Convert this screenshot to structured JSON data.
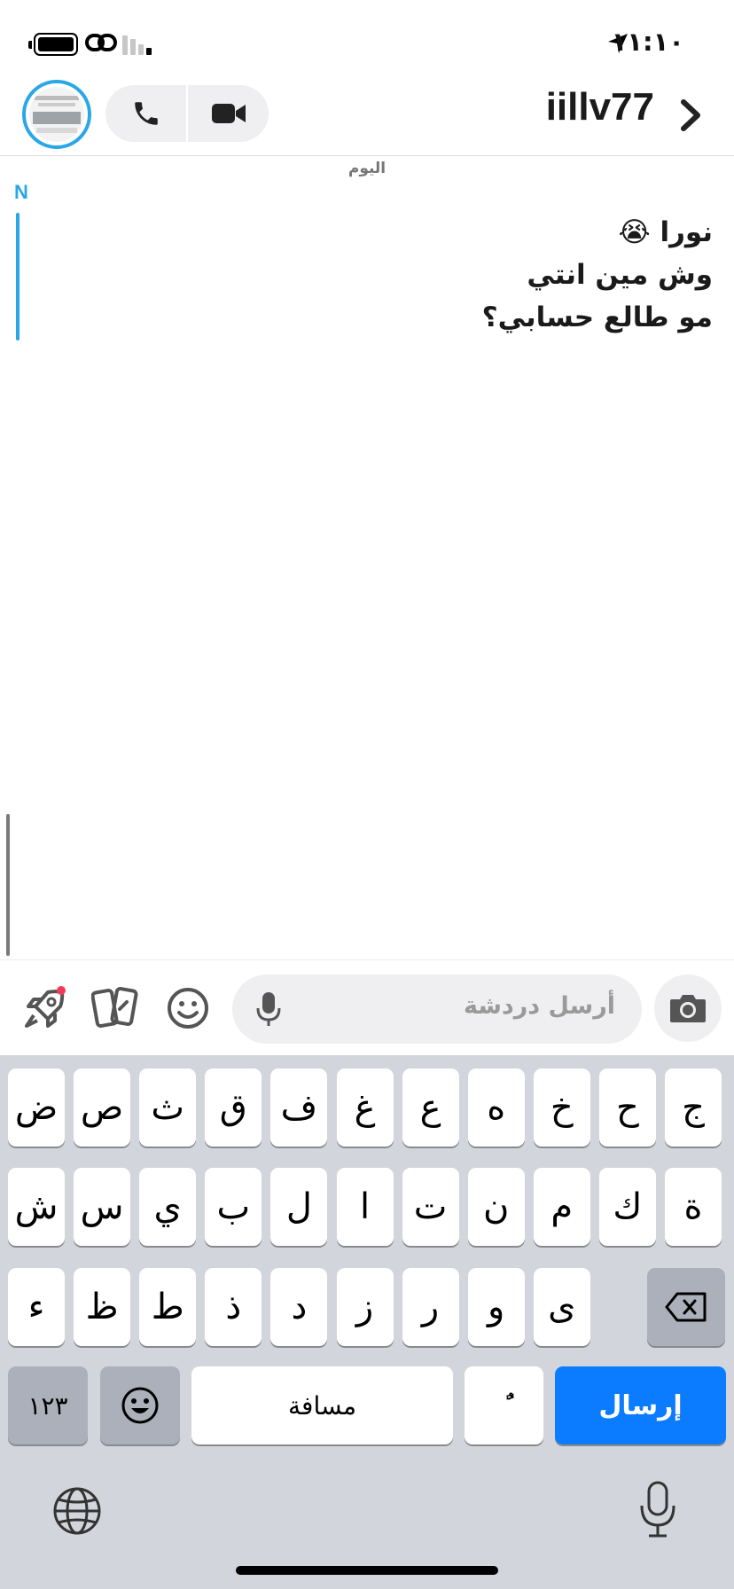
{
  "status_bar": {
    "time": "١١:١٠",
    "icons": [
      "battery-icon",
      "link-icon",
      "signal-icon",
      "location-arrow-icon"
    ]
  },
  "header": {
    "username": "iillv77",
    "icons": [
      "avatar",
      "phone-icon",
      "video-camera-icon",
      "chevron-right-icon"
    ]
  },
  "chat": {
    "date_label": "اليوم",
    "sender_initial": "N",
    "message_lines": [
      "نورا 😭",
      "وش مين انتي",
      "مو طالع حسابي؟"
    ]
  },
  "composer": {
    "placeholder": "أرسل دردشة",
    "icons": [
      "rocket-icon",
      "cards-icon",
      "smiley-icon",
      "microphone-icon",
      "camera-icon"
    ]
  },
  "keyboard": {
    "row1": [
      "ض",
      "ص",
      "ث",
      "ق",
      "ف",
      "غ",
      "ع",
      "ه",
      "خ",
      "ح",
      "ج"
    ],
    "row2": [
      "ش",
      "س",
      "ي",
      "ب",
      "ل",
      "ا",
      "ت",
      "ن",
      "م",
      "ك",
      "ة"
    ],
    "row3": [
      "ء",
      "ظ",
      "ط",
      "ذ",
      "د",
      "ز",
      "ر",
      "و",
      "ى"
    ],
    "numbers_key": "١٢٣",
    "space_key": "مسافة",
    "diacritic_key": "ًٌ",
    "send_key": "إرسال",
    "colors": {
      "send": "#0b7cff",
      "background": "#d3d5dc"
    }
  }
}
